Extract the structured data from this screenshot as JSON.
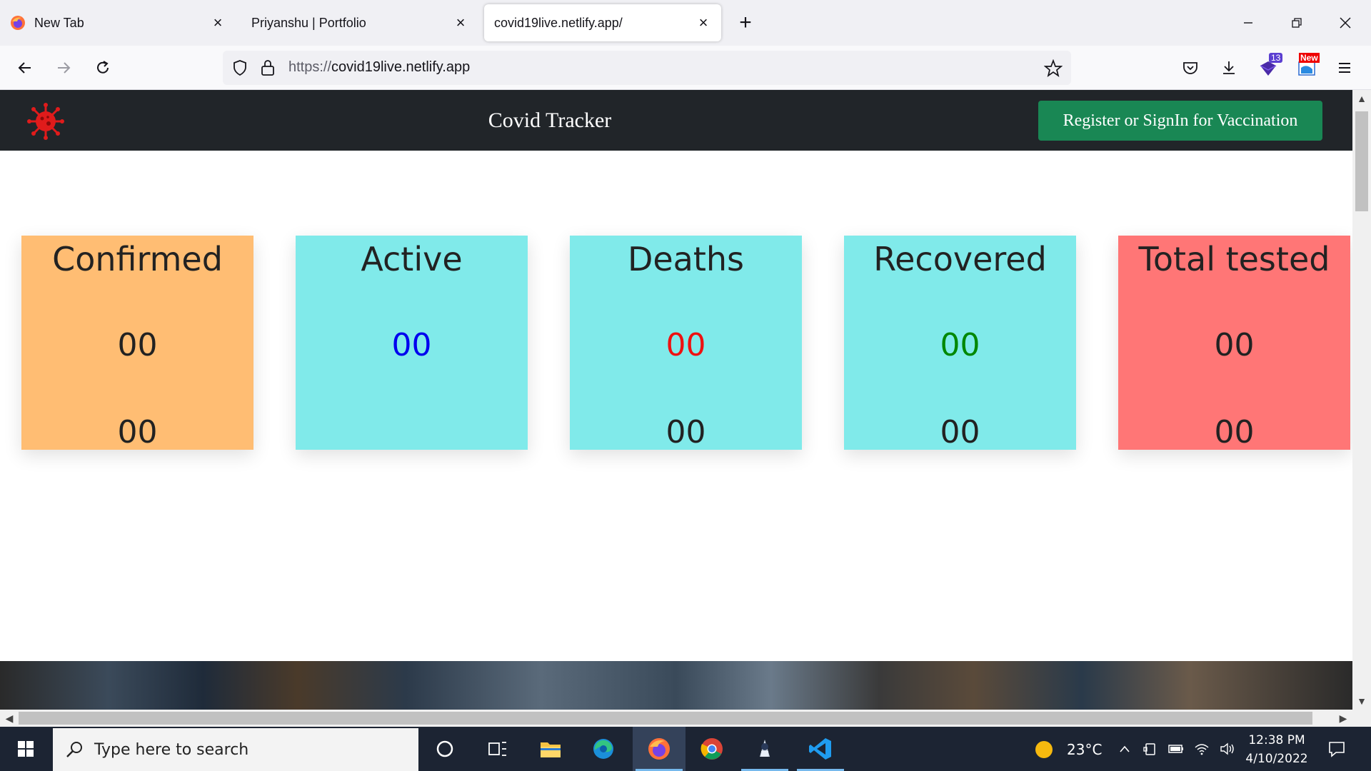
{
  "browser": {
    "tabs": [
      {
        "title": "New Tab",
        "active": false
      },
      {
        "title": "Priyanshu | Portfolio",
        "active": false
      },
      {
        "title": "covid19live.netlify.app/",
        "active": true
      }
    ],
    "url_protocol": "https://",
    "url_host": "covid19live.netlify.app",
    "extension_badges": {
      "shield_ext": "13",
      "news_ext": "New"
    }
  },
  "site": {
    "title": "Covid Tracker",
    "register_button": "Register or SignIn for Vaccination",
    "cards": [
      {
        "label": "Confirmed",
        "value": "00",
        "delta": "00",
        "bg": "#ffbd73",
        "value_color": "#222222"
      },
      {
        "label": "Active",
        "value": "00",
        "delta": "",
        "bg": "#80eaea",
        "value_color": "#0000ee"
      },
      {
        "label": "Deaths",
        "value": "00",
        "delta": "00",
        "bg": "#80eaea",
        "value_color": "#ee1111"
      },
      {
        "label": "Recovered",
        "value": "00",
        "delta": "00",
        "bg": "#80eaea",
        "value_color": "#008800"
      },
      {
        "label": "Total tested",
        "value": "00",
        "delta": "00",
        "bg": "#ff7676",
        "value_color": "#222222"
      }
    ]
  },
  "taskbar": {
    "search_placeholder": "Type here to search",
    "weather": "23°C",
    "time": "12:38 PM",
    "date": "4/10/2022"
  },
  "colors": {
    "header_bg": "#212529",
    "register_bg": "#198754",
    "taskbar_bg": "#1c2433"
  }
}
